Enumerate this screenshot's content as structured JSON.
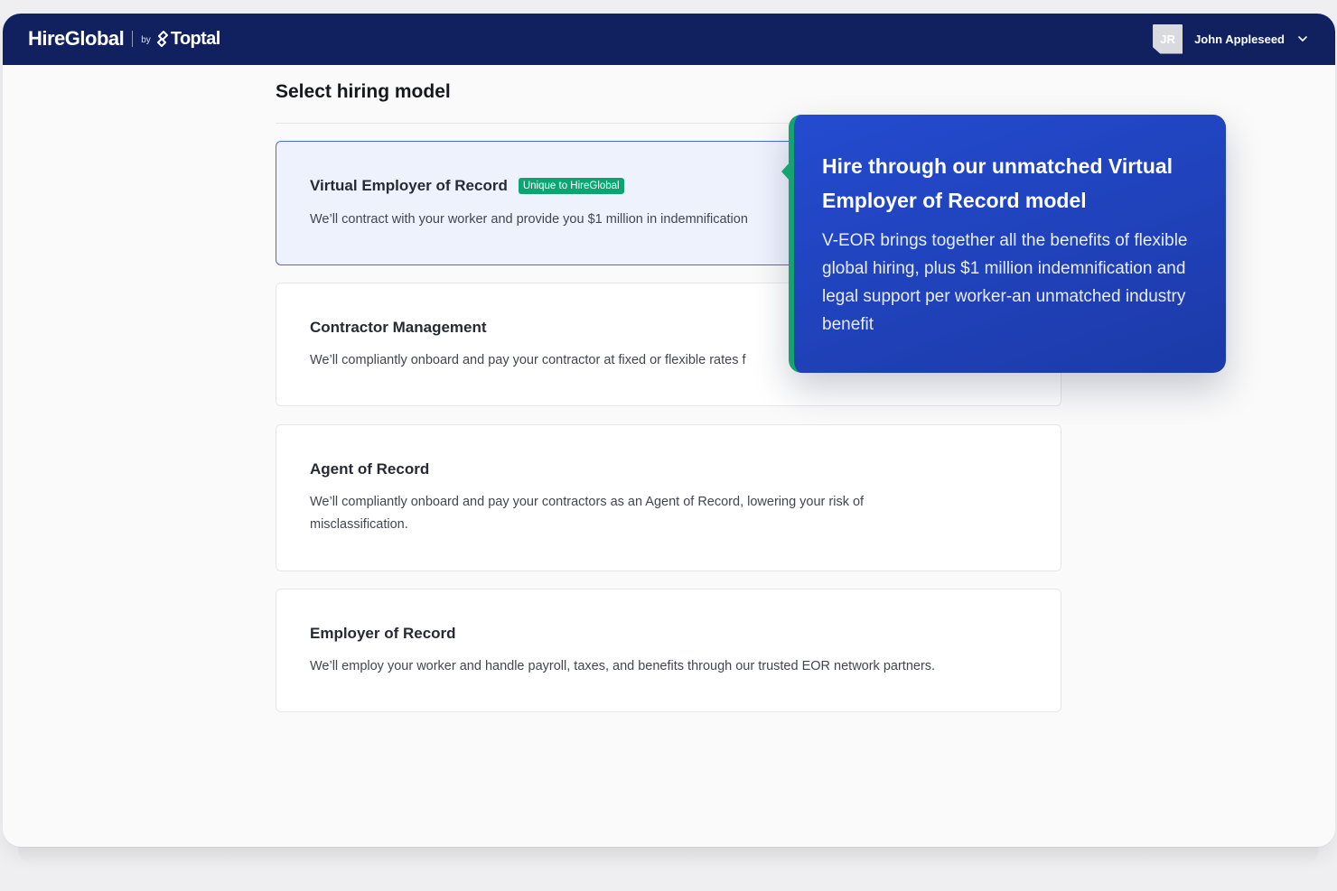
{
  "brand": {
    "name": "HireGlobal",
    "by": "by",
    "partner": "Toptal"
  },
  "user": {
    "initials": "JR",
    "name": "John Appleseed"
  },
  "page": {
    "title": "Select hiring model"
  },
  "options": [
    {
      "title": "Virtual Employer of Record",
      "badge": "Unique to HireGlobal",
      "description": "We’ll contract with your worker and provide you $1 million in indemnification",
      "selected": true
    },
    {
      "title": "Contractor Management",
      "description": "We’ll compliantly onboard and pay your contractor at fixed or flexible rates f"
    },
    {
      "title": "Agent of Record",
      "description": "We’ll compliantly onboard and pay your contractors as an Agent of Record, lowering your risk of misclassification."
    },
    {
      "title": "Employer of Record",
      "description": "We’ll employ your worker and handle payroll, taxes, and benefits through our trusted EOR network partners."
    }
  ],
  "tooltip": {
    "title": "Hire through our unmatched Virtual Employer of Record model",
    "body": "V-EOR brings together all the benefits of flexible global hiring, plus $1 million indemnification and legal support per worker-an unmatched industry benefit"
  },
  "colors": {
    "topbar": "#112160",
    "accent": "#244bd0",
    "badge": "#0aa672",
    "selected_border": "#4a6bdc"
  }
}
